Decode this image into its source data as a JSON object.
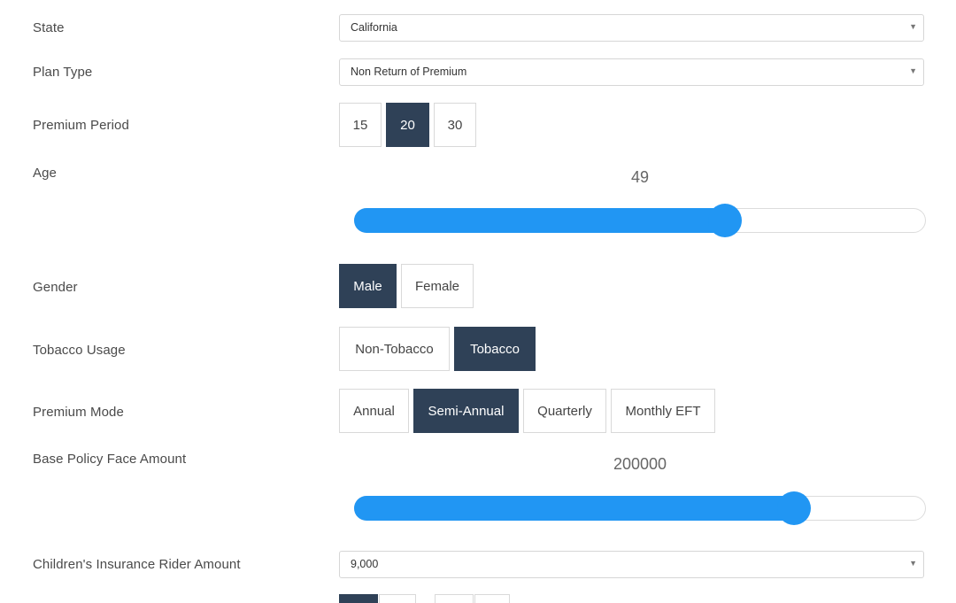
{
  "form": {
    "state": {
      "label": "State",
      "value": "California"
    },
    "plan_type": {
      "label": "Plan Type",
      "value": "Non Return of Premium"
    },
    "premium_period": {
      "label": "Premium Period",
      "options": [
        "15",
        "20",
        "30"
      ],
      "selected": "20"
    },
    "age": {
      "label": "Age",
      "value": "49",
      "fill_fraction": 0.66
    },
    "gender": {
      "label": "Gender",
      "options": [
        "Male",
        "Female"
      ],
      "selected": "Male"
    },
    "tobacco": {
      "label": "Tobacco Usage",
      "options": [
        "Non-Tobacco",
        "Tobacco"
      ],
      "selected": "Tobacco"
    },
    "premium_mode": {
      "label": "Premium Mode",
      "options": [
        "Annual",
        "Semi-Annual",
        "Quarterly",
        "Monthly EFT"
      ],
      "selected": "Semi-Annual"
    },
    "face_amount": {
      "label": "Base Policy Face Amount",
      "value": "200000",
      "fill_fraction": 0.78
    },
    "child_rider": {
      "label": "Children's Insurance Rider Amount",
      "value": "9,000"
    }
  },
  "colors": {
    "active_button": "#2f4157",
    "slider": "#2196f3"
  },
  "icons": {
    "select_caret": "chevron-down-icon"
  }
}
